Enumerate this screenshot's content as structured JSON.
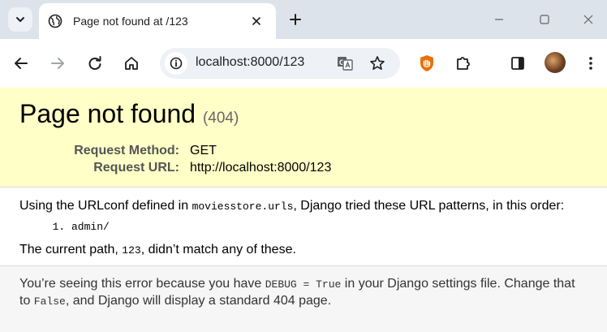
{
  "browser": {
    "tab": {
      "title": "Page not found at /123",
      "favicon": "globe-icon"
    },
    "icons": [
      "chevron-down-icon",
      "globe-icon",
      "close-icon",
      "plus-icon",
      "minimize-icon",
      "maximize-icon",
      "back-icon",
      "forward-icon",
      "reload-icon",
      "home-icon",
      "site-info-icon",
      "translate-icon",
      "star-icon",
      "extension-shield-icon",
      "puzzle-icon",
      "side-panel-icon",
      "more-vert-icon"
    ],
    "address_bar": {
      "url": "localhost:8000/123"
    }
  },
  "error": {
    "title": "Page not found",
    "code": "(404)",
    "request_method_label": "Request Method:",
    "request_method": "GET",
    "request_url_label": "Request URL:",
    "request_url": "http://localhost:8000/123"
  },
  "info": {
    "line1_prefix": "Using the URLconf defined in ",
    "urlconf": "moviesstore.urls",
    "line1_suffix": ", Django tried these URL patterns, in this order:",
    "patterns": [
      "admin/"
    ],
    "line3_prefix": "The current path, ",
    "path": "123",
    "line3_suffix": ", didn’t match any of these."
  },
  "explanation": {
    "part1": "You’re seeing this error because you have ",
    "debug": "DEBUG = True",
    "part2": " in your Django settings file. Change that to ",
    "false": "False",
    "part3": ", and Django will display a standard 404 page."
  },
  "colors": {
    "summary_bg": "#ffffc8",
    "tabstrip_bg": "#dde3ea",
    "explanation_bg": "#f6f6f6",
    "extension_orange": "#e8710a"
  }
}
